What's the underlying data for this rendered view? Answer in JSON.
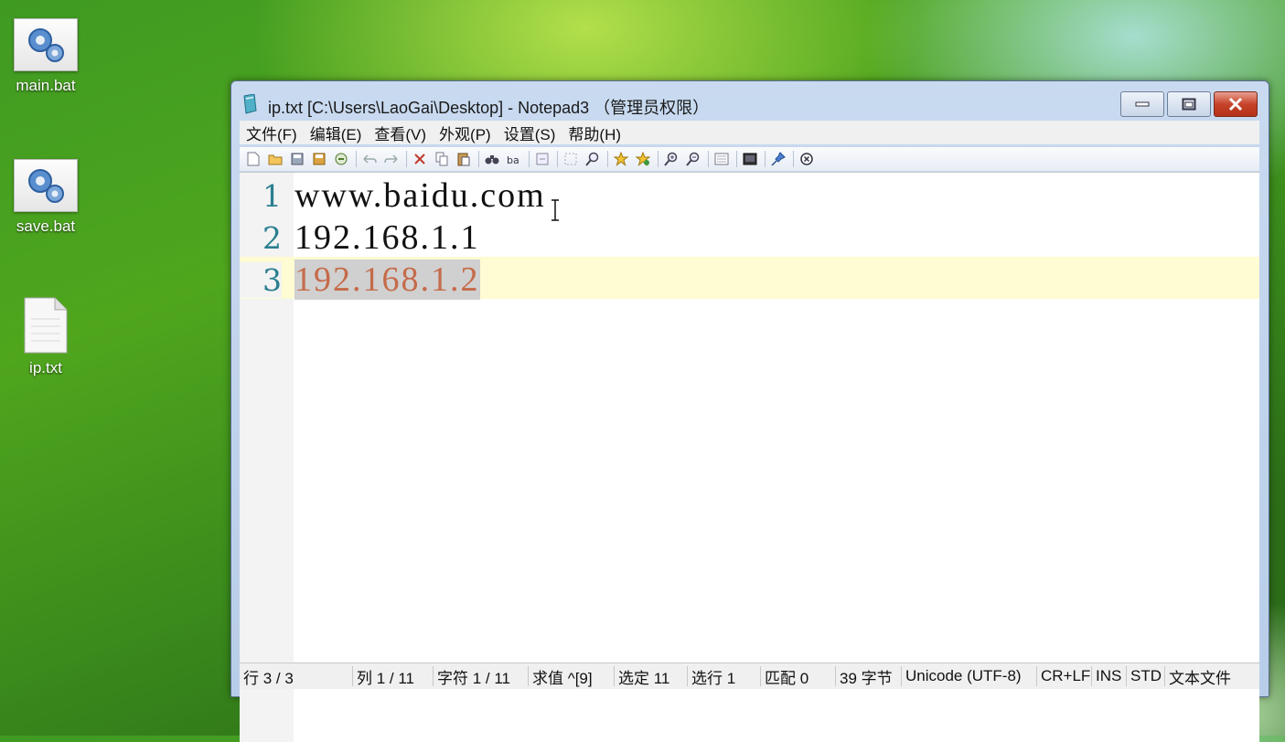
{
  "desktop": {
    "icons": [
      {
        "label": "main.bat"
      },
      {
        "label": "save.bat"
      },
      {
        "label": "ip.txt"
      }
    ]
  },
  "window": {
    "title": "ip.txt [C:\\Users\\LaoGai\\Desktop] - Notepad3 （管理员权限）",
    "menu": [
      "文件(F)",
      "编辑(E)",
      "查看(V)",
      "外观(P)",
      "设置(S)",
      "帮助(H)"
    ],
    "toolbar_icons": [
      "new-file-icon",
      "open-file-icon",
      "save-icon",
      "save-as-icon",
      "revert-icon",
      "undo-icon",
      "redo-icon",
      "cut-icon",
      "copy-icon",
      "paste-icon",
      "find-icon",
      "replace-icon",
      "goto-icon",
      "select-icon",
      "find-next-icon",
      "bookmark-icon",
      "bookmark-add-icon",
      "zoom-in-icon",
      "zoom-out-icon",
      "view-icon",
      "screen-icon",
      "pin-icon",
      "close-icon"
    ]
  },
  "editor": {
    "lines": [
      {
        "num": "1",
        "text": "www.baidu.com"
      },
      {
        "num": "2",
        "text": "192.168.1.1"
      },
      {
        "num": "3",
        "text": "192.168.1.2"
      }
    ]
  },
  "status": {
    "row": "行 3 / 3",
    "col": "列 1 / 11",
    "chars": "字符 1 / 11",
    "eval": "求值 ^[9]",
    "selected": "选定 11",
    "selected_lines": "选行 1",
    "match": "匹配 0",
    "bytes": "39 字节",
    "encoding": "Unicode (UTF-8)",
    "eol": "CR+LF",
    "ins": "INS",
    "std": "STD",
    "filetype": "文本文件"
  },
  "colors": {
    "line_number": "#2a7f8f",
    "current_line": "#fffbd2",
    "selection_text": "#c56b4a"
  }
}
